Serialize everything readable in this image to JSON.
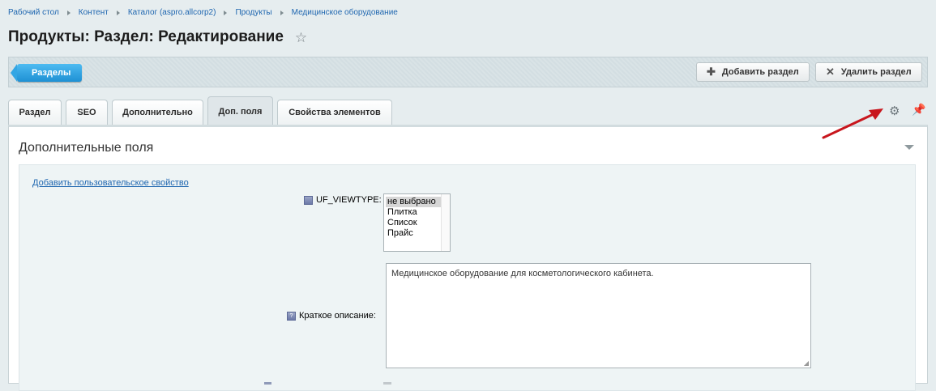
{
  "breadcrumb": [
    "Рабочий стол",
    "Контент",
    "Каталог (aspro.allcorp2)",
    "Продукты",
    "Медицинское оборудование"
  ],
  "page_title": "Продукты: Раздел: Редактирование",
  "toolbar": {
    "sections_label": "Разделы",
    "add_section_label": "Добавить раздел",
    "delete_section_label": "Удалить раздел",
    "add_icon": "plus-icon",
    "delete_icon": "close-icon"
  },
  "tabs": [
    {
      "label": "Раздел",
      "active": false
    },
    {
      "label": "SEO",
      "active": false
    },
    {
      "label": "Дополнительно",
      "active": false
    },
    {
      "label": "Доп. поля",
      "active": true
    },
    {
      "label": "Свойства элементов",
      "active": false
    }
  ],
  "section": {
    "title": "Дополнительные поля",
    "add_property_link": "Добавить пользовательское свойство",
    "viewtype": {
      "label": "UF_VIEWTYPE:",
      "options": [
        "не выбрано",
        "Плитка",
        "Список",
        "Прайс"
      ],
      "selected": "не выбрано"
    },
    "short_description": {
      "label": "Краткое описание:",
      "value": "Медицинское оборудование для косметологического кабинета."
    }
  },
  "colors": {
    "accent": "#1e90d4",
    "link": "#2067b0",
    "arrow": "#c8161d",
    "background": "#e6edef"
  }
}
